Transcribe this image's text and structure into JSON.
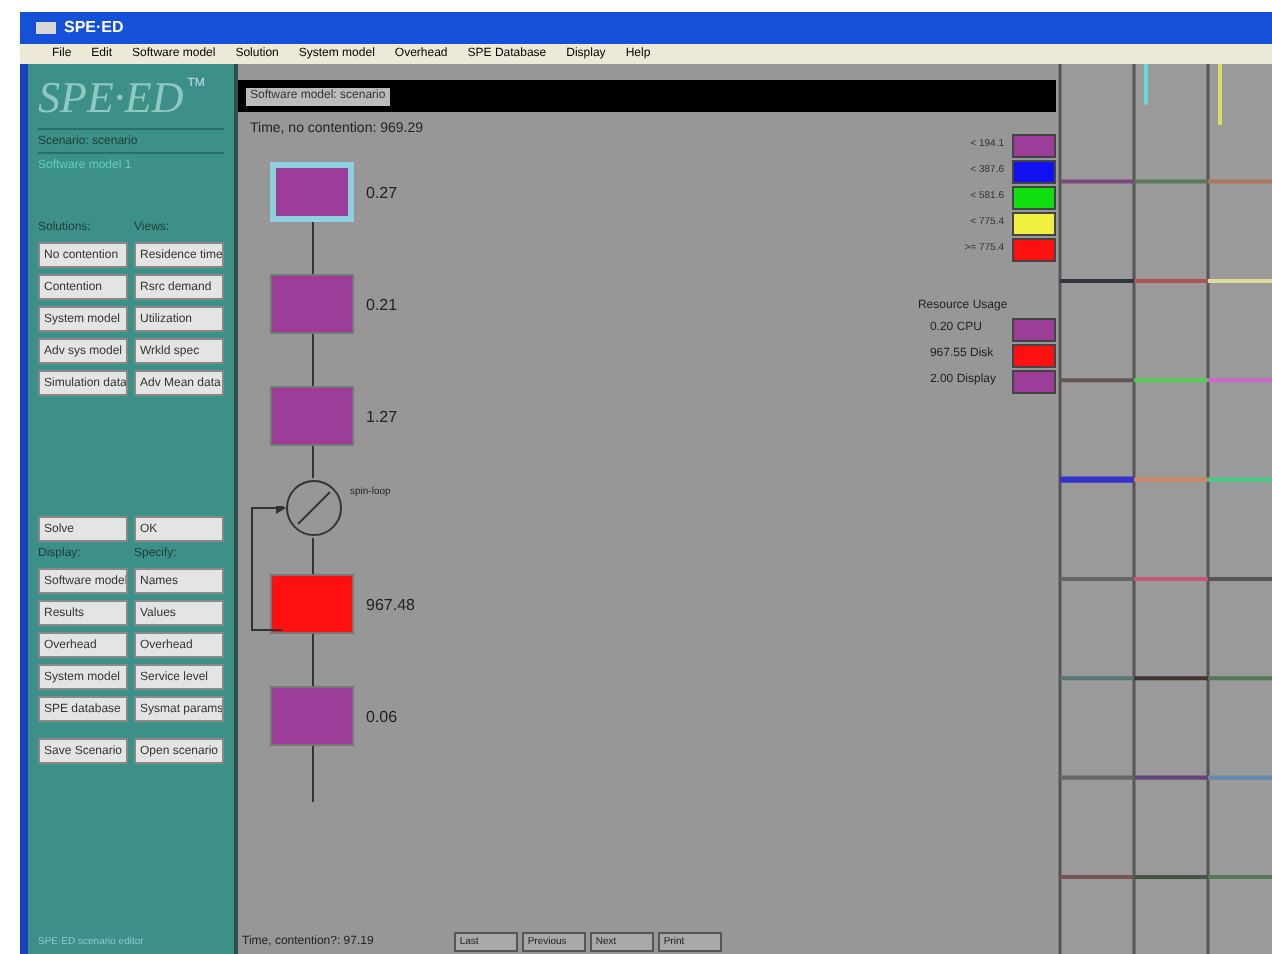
{
  "window": {
    "title": "SPE·ED"
  },
  "menu": [
    "File",
    "Edit",
    "Software model",
    "Solution",
    "System model",
    "Overhead",
    "SPE Database",
    "Display",
    "Help"
  ],
  "sidebar": {
    "logo": "SPE·ED",
    "trademark": "TM",
    "scenario": "Scenario: scenario",
    "model": "Software model 1",
    "headings": [
      "Solutions:",
      "Views:"
    ],
    "buttons": [
      [
        "No contention",
        "Residence time"
      ],
      [
        "Contention",
        "Rsrc demand"
      ],
      [
        "System model",
        "Utilization"
      ],
      [
        "Adv sys model",
        "Wrkld spec"
      ],
      [
        "Simulation data",
        "Adv Mean data"
      ]
    ],
    "action_buttons": [
      "Solve",
      "OK"
    ],
    "headings2": [
      "Display:",
      "Specify:"
    ],
    "buttons2": [
      [
        "Software model",
        "Names"
      ],
      [
        "Results",
        "Values"
      ],
      [
        "Overhead",
        "Overhead"
      ],
      [
        "System model",
        "Service level"
      ],
      [
        "SPE database",
        "Sysmat params"
      ]
    ],
    "scenario_buttons": [
      "Save Scenario",
      "Open scenario"
    ],
    "footer": "SPE·ED scenario editor"
  },
  "model_window": {
    "title": "Software model: scenario",
    "summary": "Time, no contention: 969.29",
    "nodes": [
      {
        "kind": "box",
        "value": "0.27",
        "color": "#9b3d99",
        "selected": true
      },
      {
        "kind": "box",
        "value": "0.21",
        "color": "#9b3d99",
        "selected": false
      },
      {
        "kind": "box",
        "value": "1.27",
        "color": "#9b3d99",
        "selected": false
      },
      {
        "kind": "loop",
        "label": "spin-loop"
      },
      {
        "kind": "box",
        "value": "967.48",
        "color": "#ff1010",
        "selected": false
      },
      {
        "kind": "box",
        "value": "0.06",
        "color": "#9b3d99",
        "selected": false
      }
    ],
    "legend": [
      {
        "label": "< 194.1",
        "color": "#9b3d99"
      },
      {
        "label": "< 387.6",
        "color": "#1010f0"
      },
      {
        "label": "< 581.6",
        "color": "#10e010"
      },
      {
        "label": "< 775.4",
        "color": "#f0f040"
      },
      {
        "label": ">= 775.4",
        "color": "#ff1010"
      }
    ],
    "resource_title": "Resource Usage",
    "resources": [
      {
        "label": "0.20 CPU",
        "color": "#9b3d99"
      },
      {
        "label": "967.55 Disk",
        "color": "#ff1010"
      },
      {
        "label": "2.00 Display",
        "color": "#9b3d99"
      }
    ],
    "status": "Time, contention?: 97.19",
    "nav_buttons": [
      "Last",
      "Previous",
      "Next",
      "Print"
    ]
  }
}
